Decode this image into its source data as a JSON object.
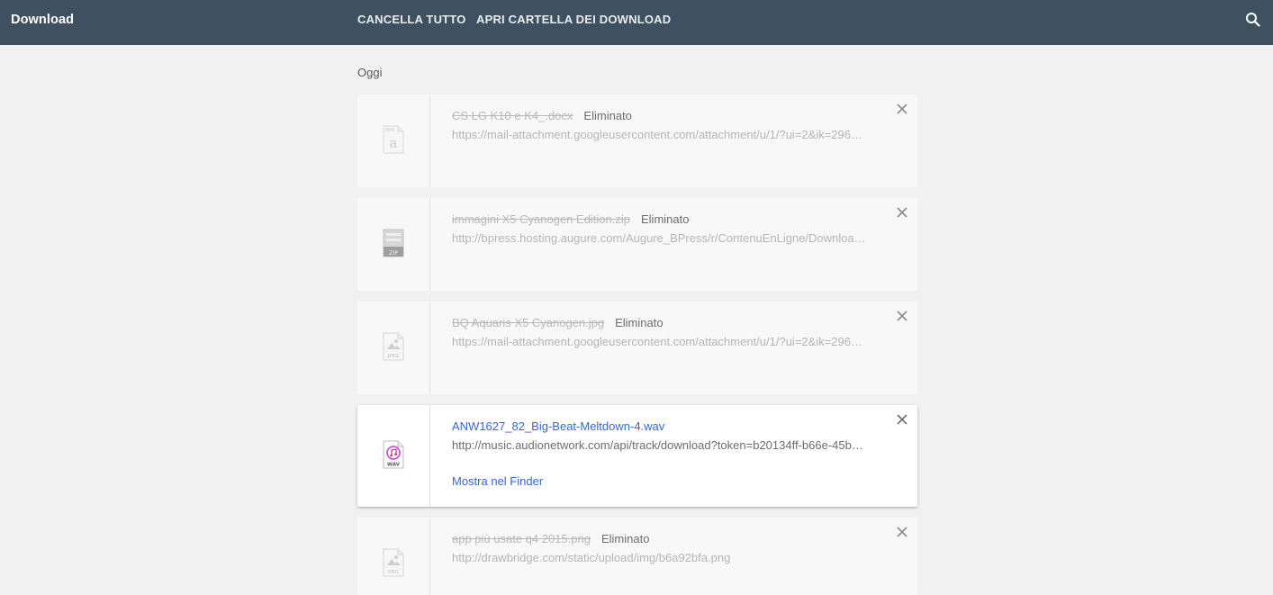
{
  "toolbar": {
    "title": "Download",
    "clear_all": "CANCELLA TUTTO",
    "open_folder": "APRI CARTELLA DEI DOWNLOAD",
    "search_icon": "search-icon"
  },
  "section": {
    "title": "Oggi"
  },
  "downloads": [
    {
      "name": "CS LG K10 e K4_.docx",
      "state": "Eliminato",
      "url": "https://mail-attachment.googleusercontent.com/attachment/u/1/?ui=2&ik=296…",
      "icon": "document-icon"
    },
    {
      "name": "immagini X5 Cyanogen Edition.zip",
      "state": "Eliminato",
      "url": "http://bpress.hosting.augure.com/Augure_BPress/r/ContenuEnLigne/Downloa…",
      "icon": "zip-file-icon",
      "icon_label": "ZIP"
    },
    {
      "name": "BQ Aquaris X5 Cyanogen.jpg",
      "state": "Eliminato",
      "url": "https://mail-attachment.googleusercontent.com/attachment/u/1/?ui=2&ik=296…",
      "icon": "jpeg-file-icon",
      "icon_label": "JPEG"
    },
    {
      "name": "ANW1627_82_Big-Beat-Meltdown-4.wav",
      "state": "",
      "url": "http://music.audionetwork.com/api/track/download?token=b20134ff-b66e-45b…",
      "action": "Mostra nel Finder",
      "icon": "wav-file-icon",
      "icon_label": "WAV"
    },
    {
      "name": "app più usate q4 2015.png",
      "state": "Eliminato",
      "url": "http://drawbridge.com/static/upload/img/b6a92bfa.png",
      "icon": "png-file-icon",
      "icon_label": "PNG"
    }
  ],
  "colors": {
    "toolbar_bg": "#3f5161",
    "page_bg": "#f1f1f1",
    "link": "#3367d6"
  }
}
